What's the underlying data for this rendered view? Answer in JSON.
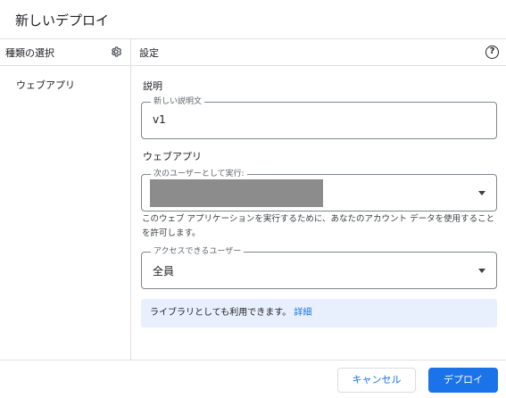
{
  "dialog": {
    "title": "新しいデプロイ"
  },
  "sidebar": {
    "header": "種類の選択",
    "settings_icon": "gear-icon",
    "items": [
      {
        "label": "ウェブアプリ"
      }
    ]
  },
  "settings": {
    "header": "設定",
    "help_icon": "help-circle-icon",
    "help_glyph": "?",
    "description": {
      "section_label": "説明",
      "field_label": "新しい説明文",
      "value": "v1"
    },
    "webapp": {
      "section_label": "ウェブアプリ",
      "execute_as": {
        "field_label": "次のユーザーとして実行:",
        "value_redacted": true
      },
      "help_text": "このウェブ アプリケーションを実行するために、あなたのアカウント データを使用することを許可します。",
      "access": {
        "field_label": "アクセスできるユーザー",
        "value": "全員"
      }
    },
    "library_info": {
      "text": "ライブラリとしても利用できます。",
      "link": "詳細"
    }
  },
  "footer": {
    "cancel_label": "キャンセル",
    "deploy_label": "デプロイ"
  },
  "colors": {
    "accent": "#1a73e8",
    "info_background": "#e8f0fe",
    "divider": "#e0e0e0",
    "redaction": "#8c8c8c"
  }
}
